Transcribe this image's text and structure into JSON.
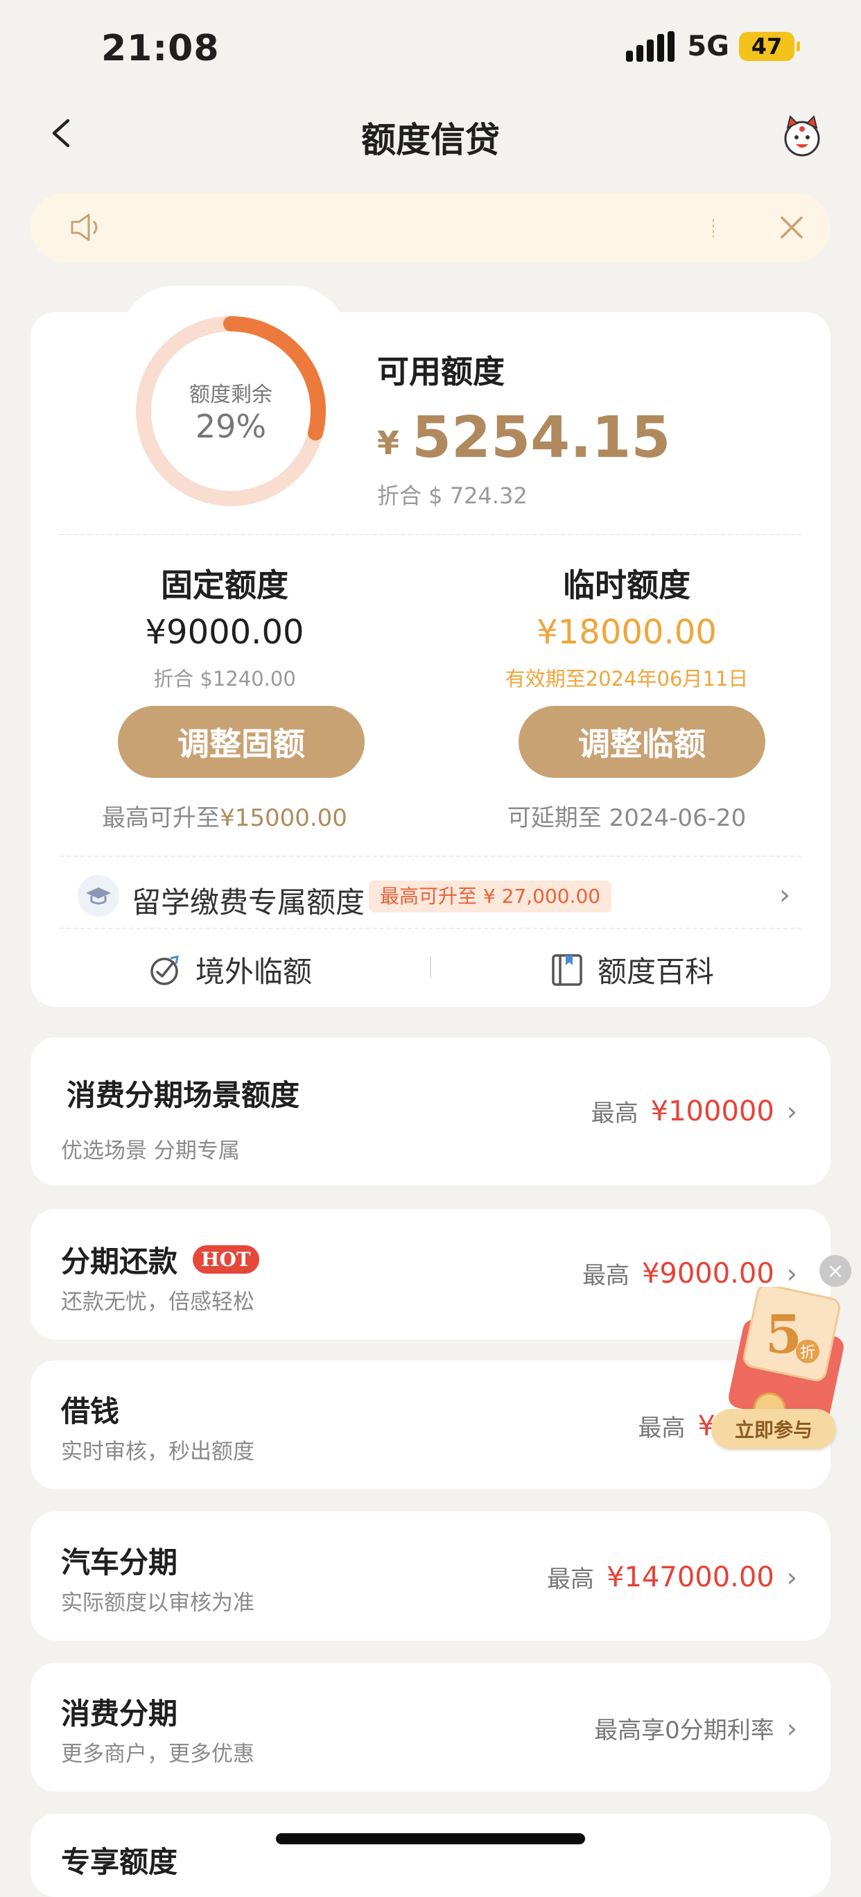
{
  "status_bar": {
    "time": "21:08",
    "network": "5G",
    "battery": "47"
  },
  "nav": {
    "title": "额度信贷"
  },
  "summary": {
    "ring_label": "额度剩余",
    "ring_percent": "29%",
    "ring_fraction": 0.29,
    "available_label": "可用额度",
    "available_currency": "¥",
    "available_amount": "5254.15",
    "available_converted": "折合 $ 724.32"
  },
  "fixed_quota": {
    "title": "固定额度",
    "amount": "¥9000.00",
    "converted": "折合 $1240.00",
    "button": "调整固额",
    "hint_prefix": "最高可升至",
    "hint_value": "¥15000.00"
  },
  "temp_quota": {
    "title": "临时额度",
    "amount": "¥18000.00",
    "validity": "有效期至2024年06月11日",
    "button": "调整临额",
    "hint": "可延期至 2024-06-20"
  },
  "study_abroad": {
    "label": "留学缴费专属额度",
    "badge": "最高可升至 ¥ 27,000.00"
  },
  "quick_links": [
    {
      "label": "境外临额"
    },
    {
      "label": "额度百科"
    }
  ],
  "list": [
    {
      "title": "消费分期场景额度",
      "subtitle": "优选场景 分期专属",
      "prefix": "最高",
      "amount": "¥100000"
    },
    {
      "title": "分期还款",
      "badge": "HOT",
      "subtitle": "还款无忧，倍感轻松",
      "prefix": "最高",
      "amount": "¥9000.00"
    },
    {
      "title": "借钱",
      "subtitle": "实时审核，秒出额度",
      "prefix": "最高",
      "amount": "¥"
    },
    {
      "title": "汽车分期",
      "subtitle": "实际额度以审核为准",
      "prefix": "最高",
      "amount": "¥147000.00"
    },
    {
      "title": "消费分期",
      "subtitle": "更多商户，更多优惠",
      "prefix": "最高享0分期利率",
      "amount": ""
    },
    {
      "title": "专享额度"
    }
  ],
  "promo": {
    "discount_digit": "5",
    "discount_unit": "折",
    "button": "立即参与"
  },
  "colors": {
    "accent_gold": "#c9a274",
    "orange": "#f0a53a",
    "red": "#e64236",
    "ring": "#ec7a3c"
  }
}
